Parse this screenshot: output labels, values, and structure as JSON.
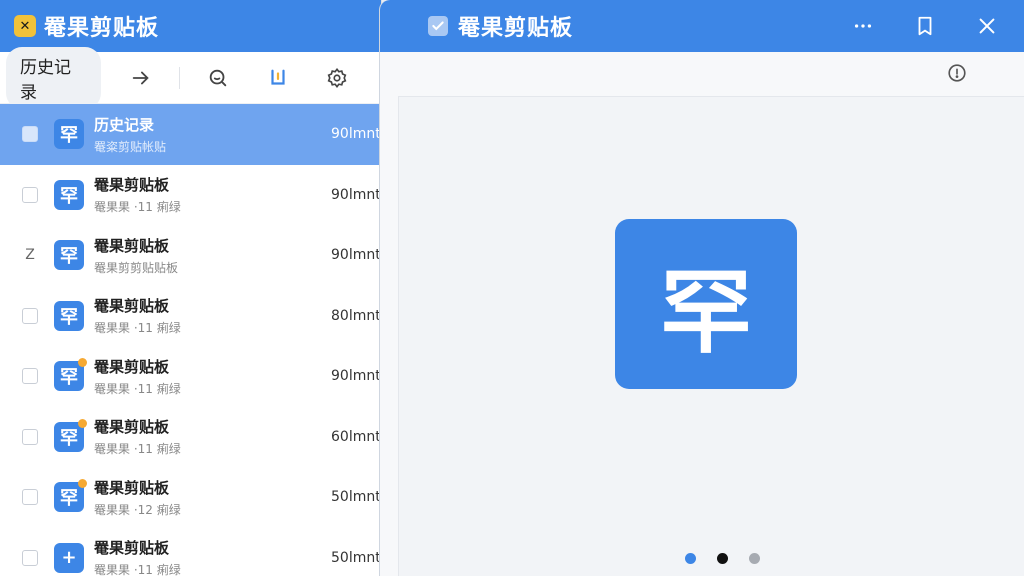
{
  "left_window": {
    "logo_glyph": "✕",
    "title": "罨果剪贴板"
  },
  "toolbar": {
    "history_tab": "历史记录",
    "icons": [
      "arrow-right-icon",
      "search-icon",
      "bracket-icon",
      "gear-icon"
    ]
  },
  "list": {
    "items": [
      {
        "title": "历史记录",
        "sub": "罨粢剪贴帐贴",
        "size": "90lmnt",
        "glyph": "罕",
        "dot": false,
        "selected": true
      },
      {
        "title": "罨果剪贴板",
        "sub": "罨果果 ·11 痢绿",
        "size": "90lmnt",
        "glyph": "罕",
        "dot": false,
        "selected": false
      },
      {
        "title": "罨果剪贴板",
        "sub": "罨果剪剪贴贴板",
        "size": "90lmnt",
        "glyph": "罕",
        "dot": false,
        "selected": false,
        "edit_mark": "Z"
      },
      {
        "title": "罨果剪贴板",
        "sub": "罨果果 ·11 痢绿",
        "size": "80lmnt",
        "glyph": "罕",
        "dot": false,
        "selected": false
      },
      {
        "title": "罨果剪贴板",
        "sub": "罨果果 ·11 痢绿",
        "size": "90lmnt",
        "glyph": "罕",
        "dot": true,
        "selected": false
      },
      {
        "title": "罨果剪贴板",
        "sub": "罨果果 ·11 痢绿",
        "size": "60lmnt",
        "glyph": "罕",
        "dot": true,
        "selected": false
      },
      {
        "title": "罨果剪贴板",
        "sub": "罨果果 ·12 痢绿",
        "size": "50lmnt",
        "glyph": "罕",
        "dot": true,
        "selected": false
      },
      {
        "title": "罨果剪贴板",
        "sub": "罨果果 ·11 痢绿",
        "size": "50lmnt",
        "glyph": "+",
        "dot": false,
        "selected": false
      }
    ]
  },
  "right_window": {
    "title": "罨果剪贴板",
    "actions": [
      "more-icon",
      "bookmark-icon",
      "close-icon"
    ],
    "preview_glyph": "罕",
    "page_dots": [
      {
        "color": "#3d86e6"
      },
      {
        "color": "#111111"
      },
      {
        "color": "#a7abb2"
      }
    ]
  },
  "colors": {
    "accent": "#3d86e6",
    "selected_row": "#6fa4ef",
    "badge": "#f6a933",
    "logo": "#f2c23a"
  }
}
